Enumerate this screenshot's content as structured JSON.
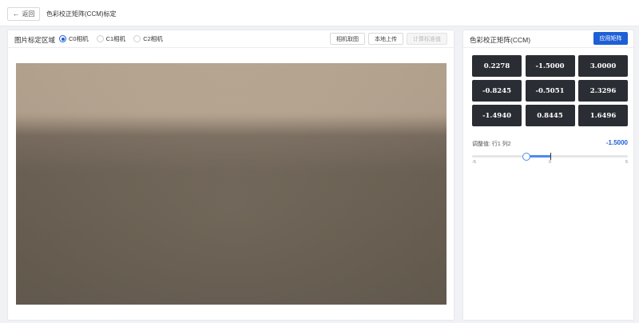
{
  "header": {
    "back_label": "返回",
    "back_icon": "arrow-left-icon",
    "title": "色彩校正矩阵(CCM)标定"
  },
  "left_panel": {
    "title": "图片标定区域",
    "cameras": [
      {
        "label": "C0相机",
        "checked": true
      },
      {
        "label": "C1相机",
        "checked": false
      },
      {
        "label": "C2相机",
        "checked": false
      }
    ],
    "buttons": {
      "capture": "相机取图",
      "upload": "本地上传",
      "compute": "计算标准值"
    }
  },
  "right_panel": {
    "title": "色彩校正矩阵(CCM)",
    "apply_label": "应用矩阵",
    "matrix": [
      "0.2278",
      "-1.5000",
      "3.0000",
      "-0.8245",
      "-0.5051",
      "2.3296",
      "-1.4940",
      "0.8445",
      "1.6496"
    ],
    "adjust_label": "调整值: 行1 列2",
    "adjust_value": "-1.5000",
    "slider": {
      "min": -5,
      "max": 5,
      "value": -1.5,
      "min_label": "-5",
      "mid_label": "0",
      "max_label": "5"
    }
  },
  "colors": {
    "primary": "#1f5fd6",
    "slider_accent": "#4a8bf5",
    "cell_bg": "#2a2d33"
  }
}
